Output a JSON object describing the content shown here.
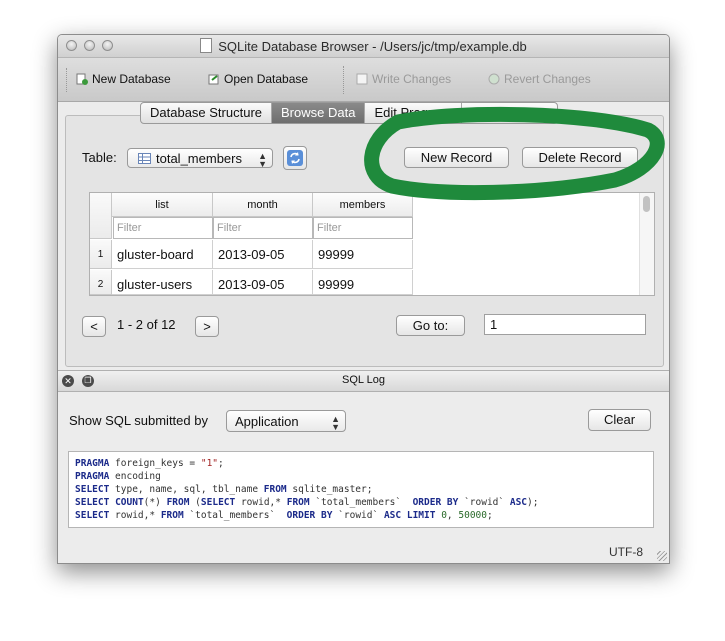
{
  "window": {
    "title": "SQLite Database Browser - /Users/jc/tmp/example.db"
  },
  "toolbar": {
    "new_database": "New Database",
    "open_database": "Open Database",
    "write_changes": "Write Changes",
    "revert_changes": "Revert Changes"
  },
  "tabs": [
    {
      "label": "Database Structure",
      "active": false
    },
    {
      "label": "Browse Data",
      "active": true
    },
    {
      "label": "Edit Pragmas",
      "active": false
    },
    {
      "label": "Execute SQL",
      "active": false
    }
  ],
  "browse": {
    "table_label": "Table:",
    "table_selected": "total_members",
    "new_record": "New Record",
    "delete_record": "Delete Record",
    "columns": [
      "list",
      "month",
      "members"
    ],
    "filter_placeholder": "Filter",
    "rows": [
      {
        "num": "1",
        "cells": [
          "gluster-board",
          "2013-09-05",
          "99999"
        ]
      },
      {
        "num": "2",
        "cells": [
          "gluster-users",
          "2013-09-05",
          "99999"
        ]
      }
    ],
    "prev": "<",
    "next": ">",
    "page_info": "1 - 2 of 12",
    "goto_label": "Go to:",
    "goto_value": "1"
  },
  "sqllog": {
    "title": "SQL Log",
    "show_label": "Show SQL submitted by",
    "source": "Application",
    "clear": "Clear",
    "lines": [
      "PRAGMA foreign_keys = \"1\";",
      "PRAGMA encoding",
      "SELECT type, name, sql, tbl_name FROM sqlite_master;",
      "SELECT COUNT(*) FROM (SELECT rowid,* FROM `total_members`  ORDER BY `rowid` ASC);",
      "SELECT rowid,* FROM `total_members`  ORDER BY `rowid` ASC LIMIT 0, 50000;"
    ]
  },
  "status": {
    "encoding": "UTF-8"
  },
  "colors": {
    "annotation": "#1f8a3c",
    "active_tab": "#7a7a7a"
  }
}
